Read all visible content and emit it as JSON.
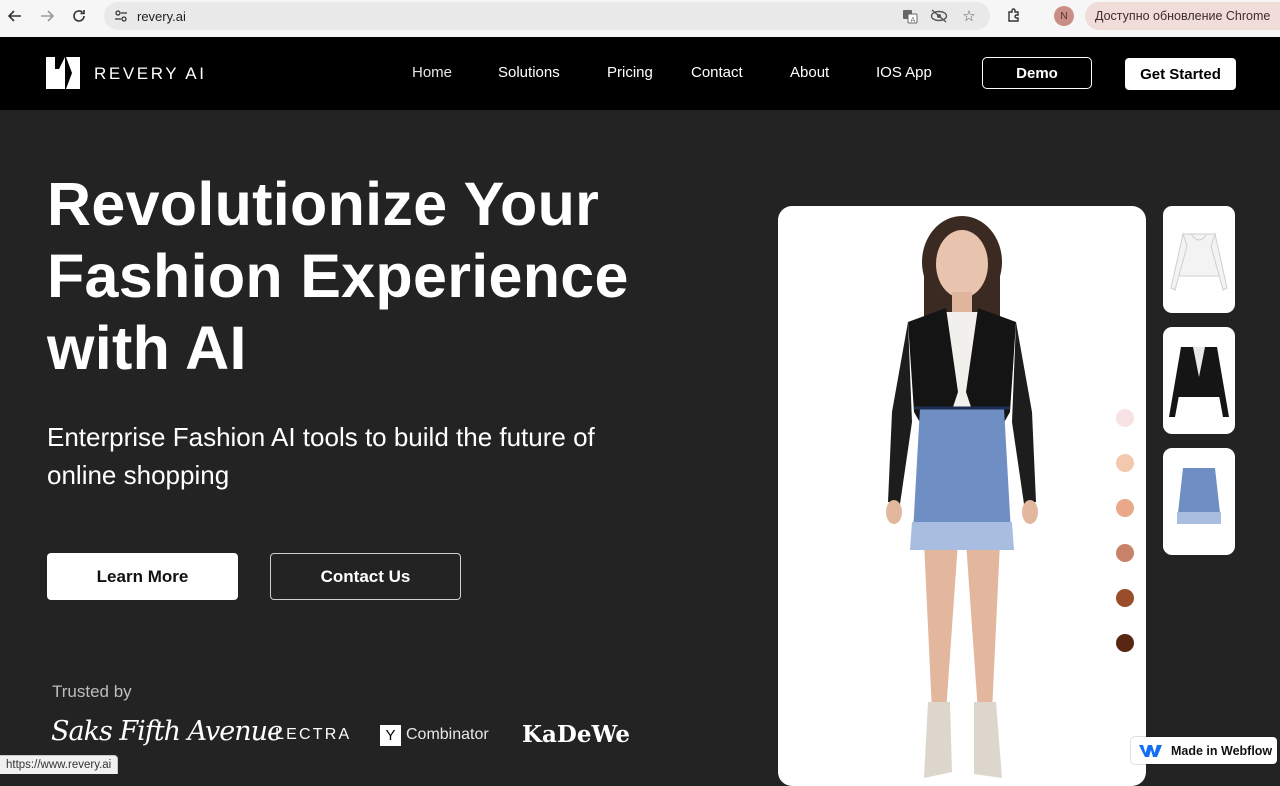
{
  "browser": {
    "url": "revery.ai",
    "update_label": "Доступно обновление Chrome",
    "profile_initial": "N"
  },
  "header": {
    "brand": "REVERY AI",
    "nav": [
      {
        "label": "Home"
      },
      {
        "label": "Solutions"
      },
      {
        "label": "Pricing"
      },
      {
        "label": "Contact"
      },
      {
        "label": "About"
      },
      {
        "label": "IOS App"
      }
    ],
    "demo_label": "Demo",
    "get_started_label": "Get Started"
  },
  "hero": {
    "title_lines": [
      "Revolutionize Your",
      "Fashion Experience",
      "with AI"
    ],
    "subtitle_lines": [
      "Enterprise Fashion AI tools to build the future of",
      "online shopping"
    ],
    "learn_more_label": "Learn More",
    "contact_us_label": "Contact Us"
  },
  "trusted": {
    "label": "Trusted by",
    "partners": [
      "Saks Fifth Avenue",
      "LECTRA",
      "Y",
      "Combinator",
      "KaDeWe"
    ]
  },
  "product": {
    "skin_tones": [
      "#f7e3e3",
      "#f2c8ae",
      "#eaa88a",
      "#c9826a",
      "#9a4d2a",
      "#5a2614"
    ],
    "thumbnails": [
      "white-corset-top",
      "black-leather-jacket",
      "blue-tweed-skirt"
    ]
  },
  "status_bar": {
    "url": "https://www.revery.ai"
  },
  "webflow_badge": {
    "label": "Made in Webflow"
  }
}
